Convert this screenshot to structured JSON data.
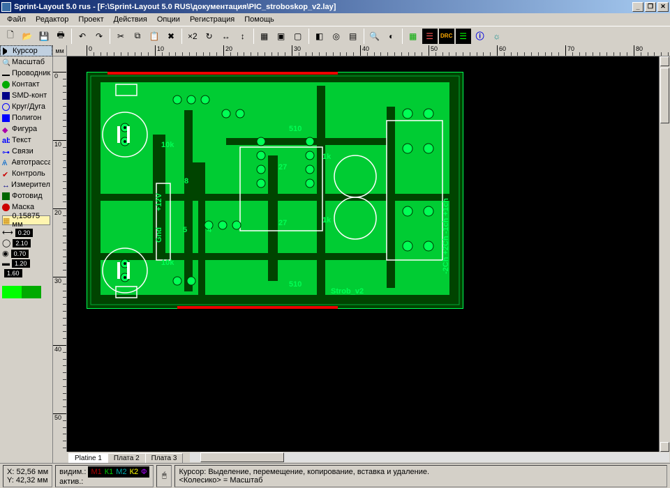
{
  "window": {
    "title": "Sprint-Layout 5.0 rus   - [F:\\Sprint-Layout 5.0 RUS\\документация\\PIC_stroboskop_v2.lay]"
  },
  "menu": [
    "Файл",
    "Редактор",
    "Проект",
    "Действия",
    "Опции",
    "Регистрация",
    "Помощь"
  ],
  "toolbox_items": [
    {
      "label": "Курсор",
      "active": true
    },
    {
      "label": "Масштаб"
    },
    {
      "label": "Проводник"
    },
    {
      "label": "Контакт"
    },
    {
      "label": "SMD-конт"
    },
    {
      "label": "Круг/Дуга"
    },
    {
      "label": "Полигон"
    },
    {
      "label": "Фигура"
    },
    {
      "label": "Текст"
    },
    {
      "label": "Связи"
    },
    {
      "label": "Автотрасса"
    },
    {
      "label": "Контроль"
    },
    {
      "label": "Измеритель"
    },
    {
      "label": "Фотовид"
    },
    {
      "label": "Маска"
    }
  ],
  "props": {
    "grid": "0,15875 мм",
    "vals": [
      "0.20",
      "2.10",
      "0.70",
      "1.20",
      "1.60"
    ]
  },
  "ruler": {
    "unit": "мм",
    "h": [
      "0",
      "10",
      "20",
      "30",
      "40",
      "50",
      "60",
      "70",
      "80"
    ],
    "v": [
      "0",
      "10",
      "20",
      "30",
      "40",
      "50"
    ]
  },
  "tabs": [
    {
      "label": "Platine 1",
      "active": true
    },
    {
      "label": "Плата  2"
    },
    {
      "label": "Плата  3"
    }
  ],
  "status": {
    "x": "X:  52,56  мм",
    "y": "Y:  42,32  мм",
    "visible_label": "видим.:",
    "active_label": "актив.:",
    "layers": [
      "М1",
      "К1",
      "М2",
      "К2",
      "Ф"
    ],
    "hint1": "Курсор: Выделение, перемещение, копирование, вставка и удаление.",
    "hint2": "<Колесико> = Масштаб"
  },
  "pcb_labels": {
    "tenk_a": "10k",
    "tenk_b": "10k",
    "fiveten_a": "510",
    "fiveten_b": "510",
    "onek_a": "1k",
    "onek_b": "1k",
    "twoseven_a": "27",
    "twoseven_b": "27",
    "p5": "5",
    "p4": "4",
    "p8": "8",
    "twelve_v": "+12V",
    "gnd": "Gnd",
    "name": "Strob_v2",
    "ch": "-2Ch  +2Ch  -1ch  +1ch"
  }
}
